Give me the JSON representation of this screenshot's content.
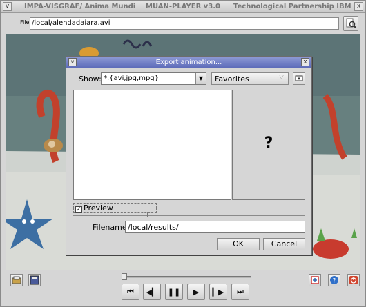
{
  "window": {
    "title_left": "IMPA-VISGRAF/ Anima Mundi",
    "title_center": "MUAN-PLAYER v3.0",
    "title_right": "Technological Partnership IBM",
    "menu_glyph": "v",
    "close_glyph": "x"
  },
  "file_bar": {
    "label": "File:",
    "value": "/local/alendadaiara.avi",
    "browse_icon": "magnifier-icon"
  },
  "dialog": {
    "title": "Export animation...",
    "menu_glyph": "v",
    "close_glyph": "x",
    "show_label": "Show:",
    "show_value": "*.{avi,jpg,mpg}",
    "favorites_label": "Favorites",
    "preview_placeholder": "?",
    "preview_label": "Preview",
    "preview_checked": true,
    "filename_label": "Filename:",
    "filename_value": "/local/results/",
    "ok_label": "OK",
    "cancel_label": "Cancel"
  },
  "playback": {
    "slider_position": 0.0,
    "buttons": [
      "first-frame-icon",
      "step-back-icon",
      "pause-icon",
      "play-icon",
      "step-forward-icon",
      "last-frame-icon"
    ]
  },
  "colors": {
    "dialog_title_bg": "#5a68b8",
    "video_bg": "#6f8a8e"
  }
}
